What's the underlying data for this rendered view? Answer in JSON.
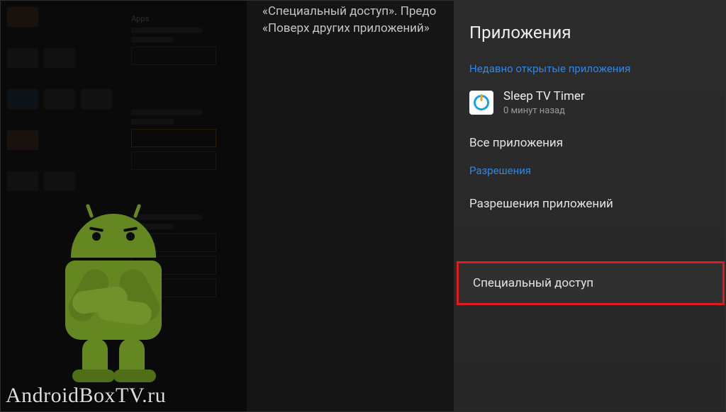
{
  "mid_overlay": {
    "line1": "«Специальный доступ». Предо",
    "line2": "«Поверх других приложений»"
  },
  "panel": {
    "title": "Приложения",
    "sections": {
      "recent_label": "Недавно открытые приложения",
      "permissions_label": "Разрешения"
    },
    "recent_app": {
      "name": "Sleep TV Timer",
      "sub": "0 минут назад",
      "icon_name": "power-icon"
    },
    "rows": {
      "all_apps": "Все приложения",
      "app_permissions": "Разрешения приложений",
      "special_access": "Специальный доступ"
    }
  },
  "left_col_header": "Apps",
  "watermark": "AndroidBoxTV.ru"
}
